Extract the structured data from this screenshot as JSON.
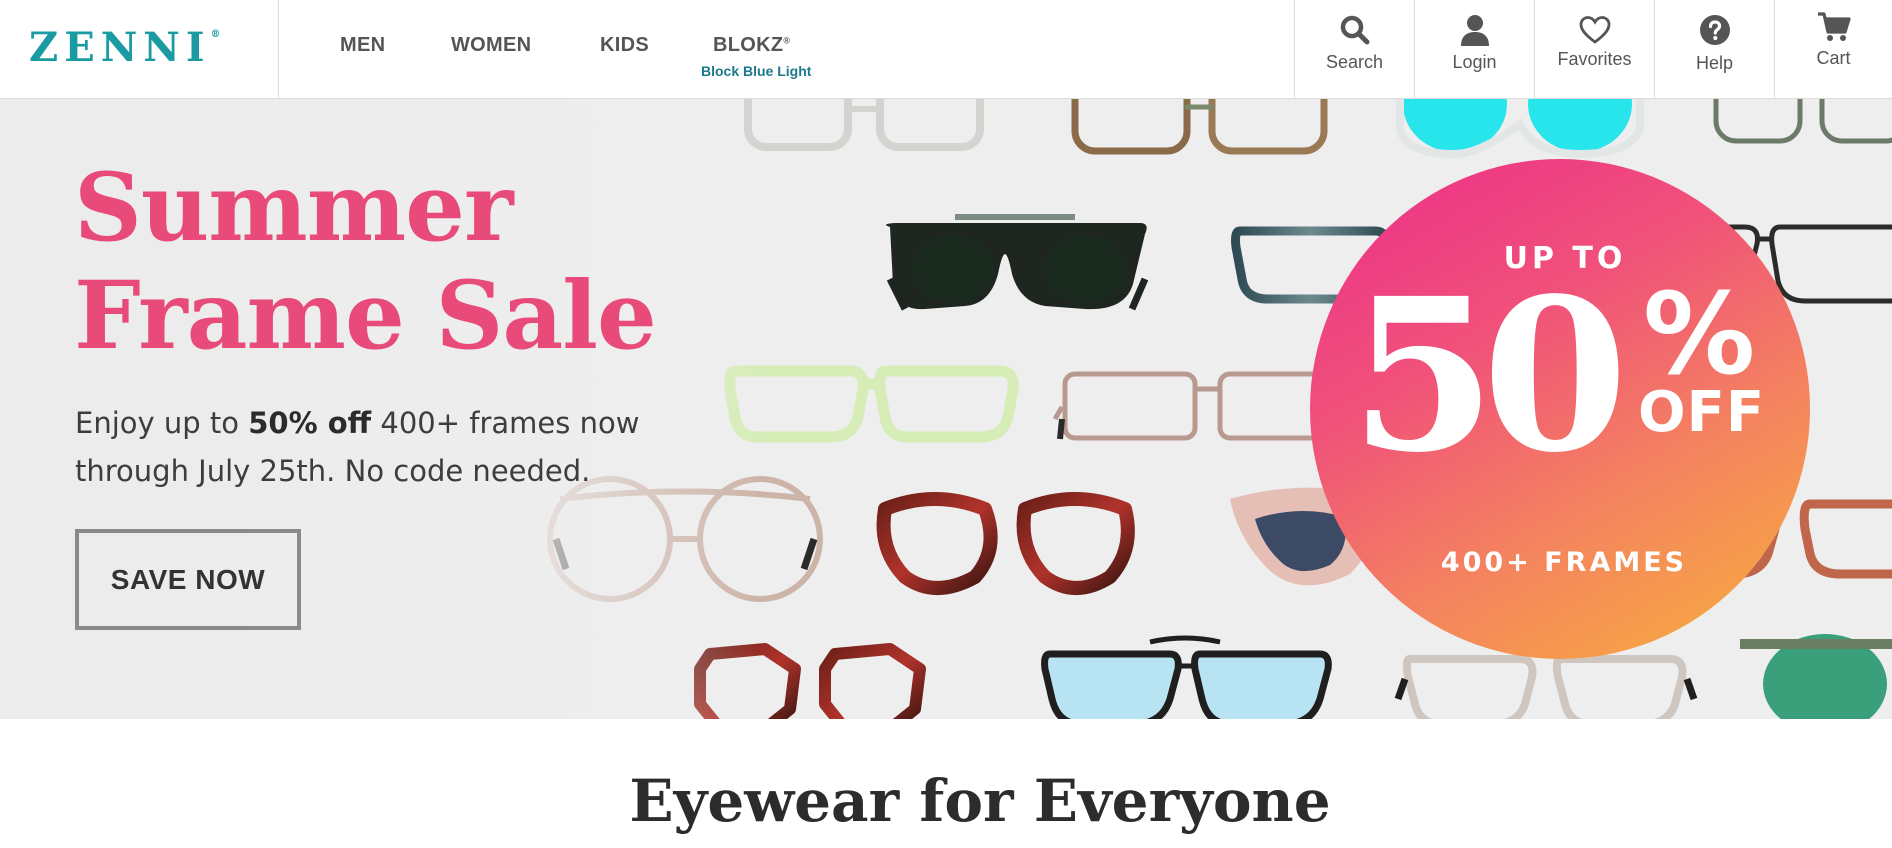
{
  "header": {
    "logo_text": "ZENNI",
    "logo_mark": "®",
    "nav": [
      {
        "label": "MEN"
      },
      {
        "label": "WOMEN"
      },
      {
        "label": "KIDS"
      },
      {
        "label": "BLOKZ",
        "mark": "®",
        "sublabel": "Block Blue Light"
      }
    ],
    "utility": [
      {
        "label": "Search",
        "icon": "search-icon"
      },
      {
        "label": "Login",
        "icon": "user-icon"
      },
      {
        "label": "Favorites",
        "icon": "heart-icon"
      },
      {
        "label": "Help",
        "icon": "help-icon"
      },
      {
        "label": "Cart",
        "icon": "cart-icon"
      }
    ]
  },
  "hero": {
    "title_line1": "Summer",
    "title_line2": "Frame Sale",
    "copy_prefix": "Enjoy up to ",
    "copy_bold": "50% off",
    "copy_suffix": " 400+ frames now",
    "copy_line2": "through July 25th. No code needed.",
    "cta_label": "SAVE NOW",
    "badge": {
      "up_to": "UP TO",
      "number": "50",
      "percent": "%",
      "off": "OFF",
      "frames": "400+ FRAMES"
    }
  },
  "section": {
    "title": "Eyewear for Everyone"
  },
  "colors": {
    "brand_teal": "#1a9aa3",
    "headline_pink": "#e84a7a",
    "sublabel_teal": "#1d7a8c",
    "badge_start": "#ec2d8a",
    "badge_end": "#f8b13b"
  }
}
